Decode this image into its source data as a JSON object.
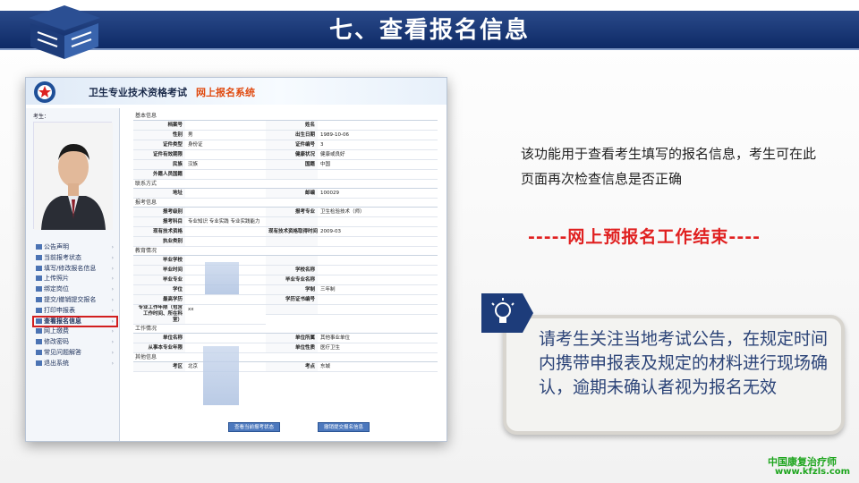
{
  "slide": {
    "title": "七、查看报名信息",
    "description": "该功能用于查看考生填写的报名信息，考生可在此页面再次检查信息是否正确",
    "end_line": "-----网上预报名工作结束----",
    "note": "请考生关注当地考试公告，在规定时间内携带申报表及规定的材料进行现场确认，逾期未确认者视为报名无效",
    "brand_cn": "中国康复治疗师",
    "brand_url": "www.kfzls.com",
    "colors": {
      "title_bar": "#1b3a78",
      "accent_red": "#e02020",
      "note_text": "#2c4478",
      "brand_green": "#1ea51e"
    }
  },
  "screenshot": {
    "header_title": "卫生专业技术资格考试",
    "header_subtitle": "网上报名系统",
    "user_label": "考生：",
    "menu": [
      {
        "label": "公告声明",
        "icon": "speaker-icon"
      },
      {
        "label": "当前报考状态",
        "icon": "status-icon"
      },
      {
        "label": "填写/修改报名信息",
        "icon": "edit-icon"
      },
      {
        "label": "上传照片",
        "icon": "photo-icon"
      },
      {
        "label": "绑定岗位",
        "icon": "link-icon"
      },
      {
        "label": "提交/撤销提交报名",
        "icon": "submit-icon"
      },
      {
        "label": "打印申报表",
        "icon": "print-icon"
      },
      {
        "label": "查看报名信息",
        "icon": "view-icon",
        "selected": true
      },
      {
        "label": "网上缴费",
        "icon": "pay-icon"
      },
      {
        "label": "修改密码",
        "icon": "key-icon"
      },
      {
        "label": "常见问题解答",
        "icon": "help-icon"
      },
      {
        "label": "退出系统",
        "icon": "exit-icon"
      }
    ],
    "sections": {
      "basic": "基本信息",
      "contact": "联系方式",
      "exam": "报考信息",
      "edu": "教育情况",
      "work": "工作情况",
      "other": "其他信息"
    },
    "basic": [
      [
        "档案号",
        "",
        "姓名",
        ""
      ],
      [
        "性别",
        "男",
        "出生日期",
        "1989-10-06"
      ],
      [
        "证件类型",
        "身份证",
        "证件编号",
        "3"
      ],
      [
        "证件有效期限",
        "",
        "健康状况",
        "健康或良好"
      ],
      [
        "民族",
        "汉族",
        "国籍",
        "中国"
      ],
      [
        "外籍人员国籍",
        "",
        "",
        ""
      ]
    ],
    "contact": [
      [
        "地址",
        "",
        "邮编",
        "100029"
      ]
    ],
    "exam": [
      [
        "报考级别",
        "",
        "报考专业",
        "卫生检验技术（师）"
      ],
      [
        "报考科目",
        "专业知识  专业实践  专业实践能力",
        "",
        ""
      ],
      [
        "现有技术资格",
        "",
        "现有技术资格取得时间",
        "2009-03"
      ],
      [
        "执业类别",
        "",
        "",
        ""
      ]
    ],
    "edu": [
      [
        "毕业学校",
        "",
        "",
        ""
      ],
      [
        "毕业时间",
        "",
        "学校名称",
        ""
      ],
      [
        "毕业专业",
        "",
        "毕业专业名称",
        ""
      ],
      [
        "学位",
        "",
        "学制",
        "三年制"
      ],
      [
        "最高学历",
        "",
        "学历证书编号",
        ""
      ],
      [
        "专业工作年限（包含工作时间、所在科室）",
        "",
        "",
        ""
      ]
    ],
    "edu_extra": "xx",
    "work": [
      [
        "单位名称",
        "",
        "单位所属",
        "其他事业单位"
      ],
      [
        "从事本专业年限",
        "",
        "单位性质",
        "医疗卫生"
      ]
    ],
    "other": [
      [
        "考区",
        "北京",
        "考点",
        "东城"
      ]
    ],
    "buttons": {
      "status": "查看当前报考状态",
      "revoke": "撤销提交报名信息"
    }
  }
}
